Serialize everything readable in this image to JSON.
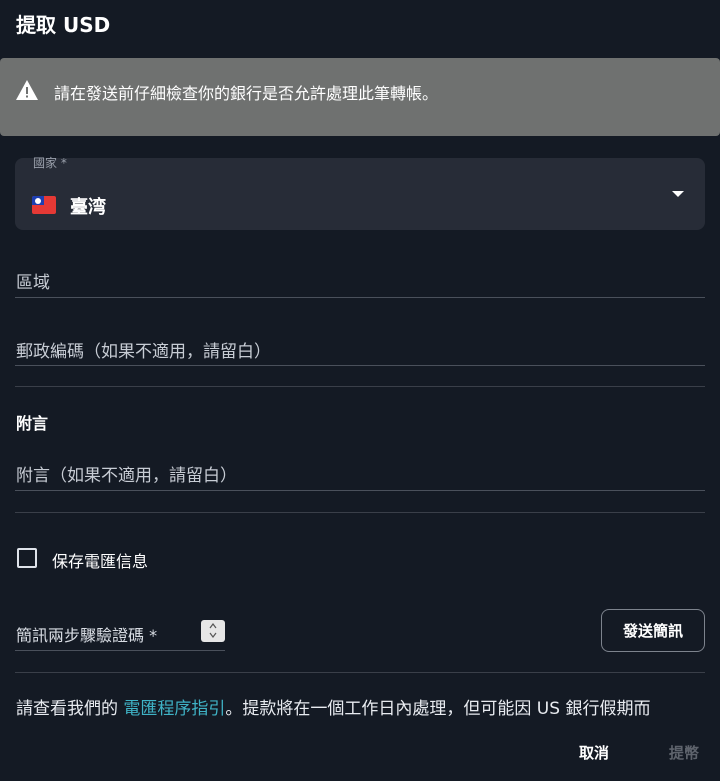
{
  "header": {
    "title": "提取 USD"
  },
  "warning": {
    "icon": "warning-icon",
    "text": "請在發送前仔細檢查你的銀行是否允許處理此筆轉帳。"
  },
  "country": {
    "label": "國家 *",
    "flag_icon": "taiwan-flag-icon",
    "value": "臺湾"
  },
  "region": {
    "placeholder": "區域"
  },
  "postal": {
    "placeholder": "郵政編碼（如果不適用，請留白）"
  },
  "remarks": {
    "section_title": "附言",
    "placeholder": "附言（如果不適用，請留白）"
  },
  "save_info": {
    "label": "保存電匯信息",
    "checked": false
  },
  "sms": {
    "label": "簡訊兩步驟驗證碼 *",
    "send_button": "發送簡訊"
  },
  "info": {
    "prefix": "請查看我們的 ",
    "link": "電匯程序指引",
    "suffix": "。提款將在一個工作日內處理，但可能因 US 銀行假期而"
  },
  "actions": {
    "cancel": "取消",
    "submit": "提幣"
  },
  "colors": {
    "background": "#141a24",
    "warning_bg": "#6f7170",
    "link": "#3fb3c6",
    "field_bg": "#272c37"
  }
}
